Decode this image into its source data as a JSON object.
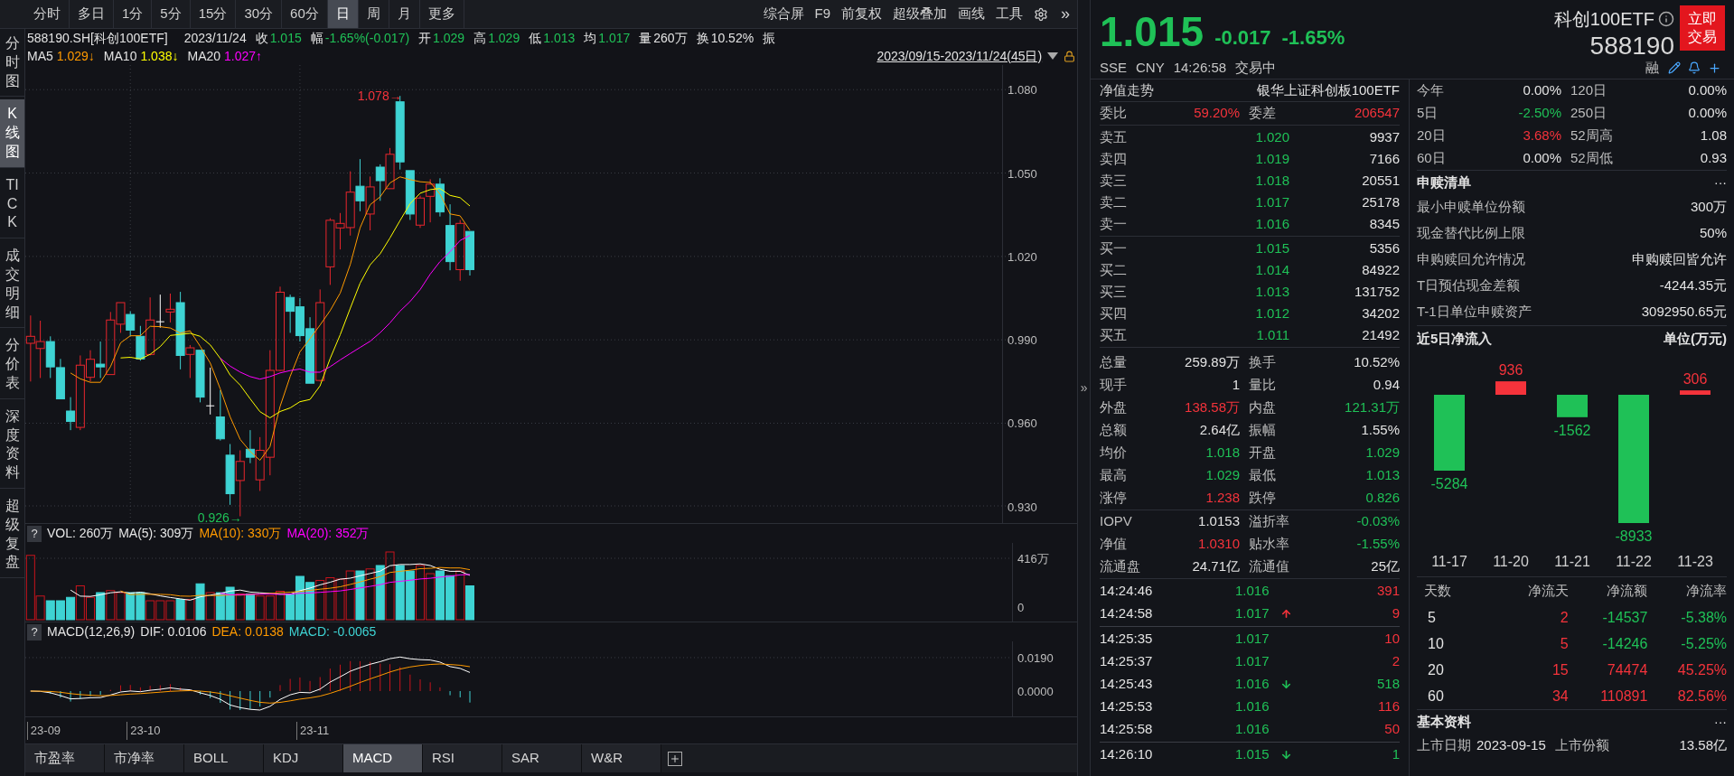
{
  "toolbar": {
    "periods": [
      {
        "label": "分时",
        "selected": false
      },
      {
        "label": "多日",
        "selected": false
      },
      {
        "label": "1分",
        "selected": false
      },
      {
        "label": "5分",
        "selected": false
      },
      {
        "label": "15分",
        "selected": false
      },
      {
        "label": "30分",
        "selected": false
      },
      {
        "label": "60分",
        "selected": false
      },
      {
        "label": "日",
        "selected": true
      },
      {
        "label": "周",
        "selected": false
      },
      {
        "label": "月",
        "selected": false
      },
      {
        "label": "更多",
        "selected": false
      }
    ],
    "tools": [
      "综合屏",
      "F9",
      "前复权",
      "超级叠加",
      "画线",
      "工具"
    ],
    "more": "»"
  },
  "side_tabs": [
    {
      "label": "分时图",
      "selected": false
    },
    {
      "label": "K线图",
      "selected": true
    },
    {
      "label": "TICK",
      "selected": false
    },
    {
      "label": "成交明细",
      "selected": false
    },
    {
      "label": "分价表",
      "selected": false
    },
    {
      "label": "深度资料",
      "selected": false
    },
    {
      "label": "超级复盘",
      "selected": false
    }
  ],
  "quote_line": {
    "code": "588190.SH[科创100ETF]",
    "date": "2023/11/24",
    "fields": [
      {
        "label": "收",
        "value": "1.015",
        "color": "#1fc157"
      },
      {
        "label": "幅",
        "value": "-1.65%(-0.017)",
        "color": "#1fc157"
      },
      {
        "label": "开",
        "value": "1.029",
        "color": "#1fc157"
      },
      {
        "label": "高",
        "value": "1.029",
        "color": "#1fc157"
      },
      {
        "label": "低",
        "value": "1.013",
        "color": "#1fc157"
      },
      {
        "label": "均",
        "value": "1.017",
        "color": "#1fc157"
      },
      {
        "label": "量",
        "value": "260万",
        "color": "#e3e3e3"
      },
      {
        "label": "换",
        "value": "10.52%",
        "color": "#e3e3e3"
      },
      {
        "label": "振"
      }
    ]
  },
  "ma_line": {
    "items": [
      {
        "label": "MA5",
        "value": "1.029↓",
        "color": "#ff9a00"
      },
      {
        "label": "MA10",
        "value": "1.038↓",
        "color": "#ffff00"
      },
      {
        "label": "MA20",
        "value": "1.027↑",
        "color": "#ff00ff"
      }
    ],
    "range": "2023/09/15-2023/11/24(45日)"
  },
  "price_chart": {
    "axis": [
      "1.080",
      "1.050",
      "1.020",
      "0.990",
      "0.960",
      "0.930"
    ],
    "high_label": "1.078→",
    "low_label": "0.926→"
  },
  "volume_panel": {
    "help": "?",
    "items": [
      {
        "text": "VOL: 260万",
        "color": "#e6e6e6"
      },
      {
        "text": "MA(5): 309万",
        "color": "#e6e6e6"
      },
      {
        "text": "MA(10): 330万",
        "color": "#ff9a00"
      },
      {
        "text": "MA(20): 352万",
        "color": "#ff00ff"
      }
    ],
    "axis": [
      "416万",
      "0"
    ]
  },
  "macd_panel": {
    "help": "?",
    "items": [
      {
        "text": "MACD(12,26,9)",
        "color": "#e6e6e6"
      },
      {
        "text": "DIF: 0.0106",
        "color": "#e6e6e6"
      },
      {
        "text": "DEA: 0.0138",
        "color": "#ff9a00"
      },
      {
        "text": "MACD: -0.0065",
        "color": "#3ed3d3"
      }
    ],
    "axis": [
      "0.0190",
      "0.0000"
    ]
  },
  "date_axis": [
    "23-09",
    "23-10",
    "23-11"
  ],
  "indicator_tabs": [
    {
      "label": "市盈率",
      "selected": false
    },
    {
      "label": "市净率",
      "selected": false
    },
    {
      "label": "BOLL",
      "selected": false
    },
    {
      "label": "KDJ",
      "selected": false
    },
    {
      "label": "MACD",
      "selected": true
    },
    {
      "label": "RSI",
      "selected": false
    },
    {
      "label": "SAR",
      "selected": false
    },
    {
      "label": "W&R",
      "selected": false
    }
  ],
  "collapse": "»",
  "quote": {
    "price": "1.015",
    "change": "-0.017",
    "change_pct": "-1.65%",
    "color": "#1fc157",
    "name": "科创100ETF",
    "code": "588190",
    "trade_button": "立即交易",
    "status": [
      "SSE",
      "CNY",
      "14:26:58",
      "交易中"
    ],
    "margin_tag": "融"
  },
  "nav_row": {
    "label": "净值走势",
    "value": "银华上证科创板100ETF"
  },
  "order_ratio": {
    "label": "委比",
    "value": "59.20%",
    "label2": "委差",
    "value2": "206547",
    "color": "#f5333b"
  },
  "asks": [
    {
      "label": "卖五",
      "price": "1.020",
      "volume": "9937",
      "color": "#1fc157"
    },
    {
      "label": "卖四",
      "price": "1.019",
      "volume": "7166",
      "color": "#1fc157"
    },
    {
      "label": "卖三",
      "price": "1.018",
      "volume": "20551",
      "color": "#1fc157"
    },
    {
      "label": "卖二",
      "price": "1.017",
      "volume": "25178",
      "color": "#1fc157"
    },
    {
      "label": "卖一",
      "price": "1.016",
      "volume": "8345",
      "color": "#1fc157"
    }
  ],
  "bids": [
    {
      "label": "买一",
      "price": "1.015",
      "volume": "5356",
      "color": "#1fc157"
    },
    {
      "label": "买二",
      "price": "1.014",
      "volume": "84922",
      "color": "#1fc157"
    },
    {
      "label": "买三",
      "price": "1.013",
      "volume": "131752",
      "color": "#1fc157"
    },
    {
      "label": "买四",
      "price": "1.012",
      "volume": "34202",
      "color": "#1fc157"
    },
    {
      "label": "买五",
      "price": "1.011",
      "volume": "21492",
      "color": "#1fc157"
    }
  ],
  "stats": [
    [
      {
        "label": "总量",
        "value": "259.89万",
        "color": "#e3e3e3"
      },
      {
        "label": "换手",
        "value": "10.52%",
        "color": "#e3e3e3"
      }
    ],
    [
      {
        "label": "现手",
        "value": "1",
        "color": "#e3e3e3"
      },
      {
        "label": "量比",
        "value": "0.94",
        "color": "#e3e3e3"
      }
    ],
    [
      {
        "label": "外盘",
        "value": "138.58万",
        "color": "#f5333b"
      },
      {
        "label": "内盘",
        "value": "121.31万",
        "color": "#1fc157"
      }
    ],
    [
      {
        "label": "总额",
        "value": "2.64亿",
        "color": "#e3e3e3"
      },
      {
        "label": "振幅",
        "value": "1.55%",
        "color": "#e3e3e3"
      }
    ],
    [
      {
        "label": "均价",
        "value": "1.018",
        "color": "#1fc157"
      },
      {
        "label": "开盘",
        "value": "1.029",
        "color": "#1fc157"
      }
    ],
    [
      {
        "label": "最高",
        "value": "1.029",
        "color": "#1fc157"
      },
      {
        "label": "最低",
        "value": "1.013",
        "color": "#1fc157"
      }
    ],
    [
      {
        "label": "涨停",
        "value": "1.238",
        "color": "#f5333b"
      },
      {
        "label": "跌停",
        "value": "0.826",
        "color": "#1fc157"
      }
    ]
  ],
  "etf_stats": [
    [
      {
        "label": "IOPV",
        "value": "1.0153",
        "color": "#e3e3e3"
      },
      {
        "label": "溢折率",
        "value": "-0.03%",
        "color": "#1fc157"
      }
    ],
    [
      {
        "label": "净值",
        "value": "1.0310",
        "color": "#f5333b"
      },
      {
        "label": "贴水率",
        "value": "-1.55%",
        "color": "#1fc157"
      }
    ],
    [
      {
        "label": "流通盘",
        "value": "24.71亿",
        "color": "#e3e3e3"
      },
      {
        "label": "流通值",
        "value": "25亿",
        "color": "#e3e3e3"
      }
    ]
  ],
  "trades": [
    [
      {
        "time": "14:24:46",
        "price": "1.016",
        "kind": "plain",
        "volume": "391",
        "color": "#f5333b"
      },
      {
        "time": "14:24:58",
        "price": "1.017",
        "kind": "uptick",
        "volume": "9",
        "color": "#f5333b"
      }
    ],
    [
      {
        "time": "14:25:35",
        "price": "1.017",
        "kind": "plain",
        "volume": "10",
        "color": "#f5333b"
      },
      {
        "time": "14:25:37",
        "price": "1.017",
        "kind": "plain",
        "volume": "2",
        "color": "#f5333b"
      },
      {
        "time": "14:25:43",
        "price": "1.016",
        "kind": "downtick",
        "volume": "518",
        "color": "#1fc157"
      },
      {
        "time": "14:25:53",
        "price": "1.016",
        "kind": "plain",
        "volume": "116",
        "color": "#f5333b"
      },
      {
        "time": "14:25:58",
        "price": "1.016",
        "kind": "plain",
        "volume": "50",
        "color": "#f5333b"
      }
    ],
    [
      {
        "time": "14:26:10",
        "price": "1.015",
        "kind": "downtick",
        "volume": "1",
        "color": "#1fc157"
      }
    ]
  ],
  "period_returns": [
    [
      {
        "label": "今年",
        "value": "0.00%",
        "color": "#e3e3e3"
      },
      {
        "label": "120日",
        "value": "0.00%",
        "color": "#e3e3e3"
      }
    ],
    [
      {
        "label": "5日",
        "value": "-2.50%",
        "color": "#1fc157"
      },
      {
        "label": "250日",
        "value": "0.00%",
        "color": "#e3e3e3"
      }
    ],
    [
      {
        "label": "20日",
        "value": "3.68%",
        "color": "#f5333b"
      },
      {
        "label": "52周高",
        "value": "1.08",
        "color": "#e3e3e3"
      }
    ],
    [
      {
        "label": "60日",
        "value": "0.00%",
        "color": "#e3e3e3"
      },
      {
        "label": "52周低",
        "value": "0.93",
        "color": "#e3e3e3"
      }
    ]
  ],
  "creation_redemption": {
    "title": "申赎清单",
    "more": "···",
    "rows": [
      {
        "label": "最小申赎单位份额",
        "value": "300万"
      },
      {
        "label": "现金替代比例上限",
        "value": "50%"
      },
      {
        "label": "申购赎回允许情况",
        "value": "申购赎回皆允许"
      },
      {
        "label": "T日预估现金差额",
        "value": "-4244.35元"
      },
      {
        "label": "T-1日单位申赎资产",
        "value": "3092950.65元"
      }
    ]
  },
  "net_inflow": {
    "title": "近5日净流入",
    "unit": "单位(万元)",
    "chart_data": {
      "type": "bar",
      "categories": [
        "11-17",
        "11-20",
        "11-21",
        "11-22",
        "11-23"
      ],
      "values": [
        -5284,
        936,
        -1562,
        -8933,
        306
      ],
      "data_labels": true
    }
  },
  "flow_table": {
    "columns": [
      "天数",
      "净流天",
      "净流额",
      "净流率"
    ],
    "rows": [
      [
        {
          "text": "5",
          "color": "#e3e3e3"
        },
        {
          "text": "2",
          "color": "#f5333b"
        },
        {
          "text": "-14537",
          "color": "#1fc157"
        },
        {
          "text": "-5.38%",
          "color": "#1fc157"
        }
      ],
      [
        {
          "text": "10",
          "color": "#e3e3e3"
        },
        {
          "text": "5",
          "color": "#f5333b"
        },
        {
          "text": "-14246",
          "color": "#1fc157"
        },
        {
          "text": "-5.25%",
          "color": "#1fc157"
        }
      ],
      [
        {
          "text": "20",
          "color": "#e3e3e3"
        },
        {
          "text": "15",
          "color": "#f5333b"
        },
        {
          "text": "74474",
          "color": "#f5333b"
        },
        {
          "text": "45.25%",
          "color": "#f5333b"
        }
      ],
      [
        {
          "text": "60",
          "color": "#e3e3e3"
        },
        {
          "text": "34",
          "color": "#f5333b"
        },
        {
          "text": "110891",
          "color": "#f5333b"
        },
        {
          "text": "82.56%",
          "color": "#f5333b"
        }
      ]
    ]
  },
  "basic_info": {
    "title": "基本资料",
    "more": "···",
    "rows": [
      {
        "label": "上市日期",
        "value": "2023-09-15",
        "label2": "上市份额",
        "value2": "13.58亿"
      }
    ]
  }
}
